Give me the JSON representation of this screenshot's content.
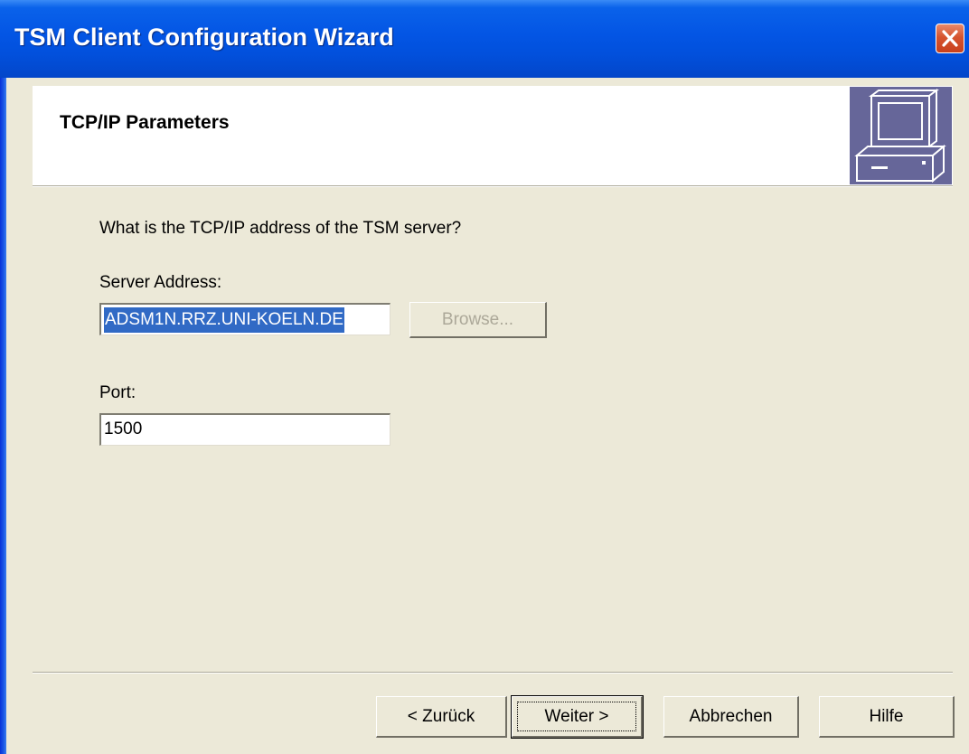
{
  "window": {
    "title": "TSM Client Configuration Wizard"
  },
  "header": {
    "title": "TCP/IP Parameters",
    "icon": "computer-icon"
  },
  "content": {
    "question": "What is the TCP/IP address of the TSM server?",
    "server_address_label": "Server Address:",
    "server_address_value": "ADSM1N.RRZ.UNI-KOELN.DE",
    "browse_label": "Browse...",
    "port_label": "Port:",
    "port_value": "1500"
  },
  "footer": {
    "back_label": "< Zurück",
    "next_label": "Weiter >",
    "cancel_label": "Abbrechen",
    "help_label": "Hilfe"
  },
  "colors": {
    "titlebar": "#0355e4",
    "dialog_bg": "#ece9d8",
    "header_icon_bg": "#666699",
    "selection": "#316ac5",
    "close_button": "#d6542f"
  }
}
